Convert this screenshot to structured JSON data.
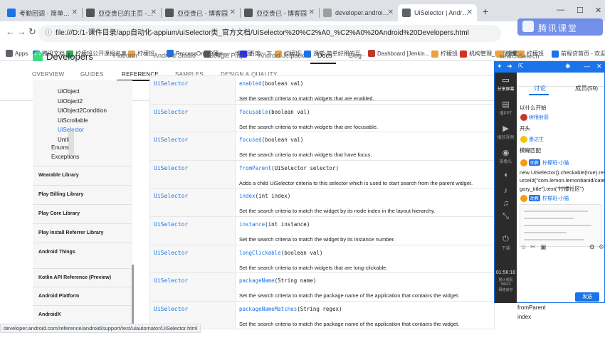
{
  "browser": {
    "tabs": [
      {
        "title": "考勤回调 · 简单好用的互动课堂S",
        "icon_color": "#1a73e8"
      },
      {
        "title": "亞亞贵已的主页 - 博客园",
        "icon_color": "#555555"
      },
      {
        "title": "亞亞贵已 - 博客园",
        "icon_color": "#555555"
      },
      {
        "title": "亞亞贵已 - 博客园",
        "icon_color": "#555555"
      },
      {
        "title": "developer.android.com",
        "icon_color": "#9e9e9e"
      },
      {
        "title": "UiSelector | Android Develop",
        "icon_color": "#5f6368"
      }
    ],
    "active_tab_index": 5,
    "new_tab_icon": "plus-icon",
    "url": "file:///D:/1-课件目录/app自动化-appium/uiSelector类_官方文档/UiSelector%20%C2%A0_%C2%A0%20Android%20Developers.html",
    "bookmarks": [
      {
        "label": "Apps",
        "color": "#5f6368"
      },
      {
        "label": "腾讯文档",
        "color": "#1a73e8"
      },
      {
        "label": "柠檬班公开课报名表",
        "color": "#34a853"
      },
      {
        "label": "柠檬班",
        "color": "#e8a33d"
      },
      {
        "label": "ProcessOn - Diagr...",
        "color": "#1a73e8"
      },
      {
        "label": "薄—— - 博客园",
        "color": "#555555"
      },
      {
        "label": "百度一下",
        "color": "#2932e1"
      },
      {
        "label": "柠檬班",
        "color": "#e8a33d"
      },
      {
        "label": "课堂-简单好用的互...",
        "color": "#1a73e8"
      },
      {
        "label": "Dashboard [Jenkin...",
        "color": "#c0392b"
      },
      {
        "label": "柠檬班",
        "color": "#e8a33d"
      },
      {
        "label": "机构管理_腾讯课堂",
        "color": "#d93025"
      },
      {
        "label": "柠檬班",
        "color": "#e8a33d"
      },
      {
        "label": "柠檬班",
        "color": "#e8a33d"
      },
      {
        "label": "前程贷首页 - 欢迎您",
        "color": "#1a73e8"
      }
    ],
    "status_url": "developer.android.com/reference/android/support/test/uiautomator/UiSelector.html"
  },
  "site": {
    "brand": "Developers",
    "top_nav": [
      "Platform",
      "Android Studio",
      "Google Play",
      "Android Jetpack",
      "Docs",
      "Blog"
    ],
    "top_nav_active": "Docs",
    "search_placeholder": "searchSearch",
    "sub_nav": [
      "OVERVIEW",
      "GUIDES",
      "REFERENCE",
      "SAMPLES",
      "DESIGN & QUALITY"
    ],
    "sub_nav_active": "REFERENCE"
  },
  "sidebar": {
    "classes": [
      "UiObject",
      "UiObject2",
      "UiObject2Condition",
      "UiScrollable",
      "UiSelector",
      "UntiI"
    ],
    "active_class": "UiSelector",
    "groups": [
      "Enums",
      "Exceptions"
    ],
    "sections": [
      "Wearable Library",
      "Play Billing Library",
      "Play Core Library",
      "Play Install Referrer Library",
      "Android Things",
      "Kotlin API Reference (Preview)",
      "Android Platform",
      "AndroidX"
    ]
  },
  "methods": [
    {
      "type": "UiSelector",
      "name": "enabled",
      "params": "(boolean val)",
      "desc": "Set the search criteria to match widgets that are enabled."
    },
    {
      "type": "UiSelector",
      "name": "focusable",
      "params": "(boolean val)",
      "desc": "Set the search criteria to match widgets that are focusable."
    },
    {
      "type": "UiSelector",
      "name": "focused",
      "params": "(boolean val)",
      "desc": "Set the search criteria to match widgets that have focus."
    },
    {
      "type": "UiSelector",
      "name": "fromParent",
      "params": "(UiSelector selector)",
      "desc": "Adds a child UiSelector criteria to this selector which is used to start search from the parent widget."
    },
    {
      "type": "UiSelector",
      "name": "index",
      "params": "(int index)",
      "desc": "Set the search criteria to match the widget by its node index in the layout hierarchy."
    },
    {
      "type": "UiSelector",
      "name": "instance",
      "params": "(int instance)",
      "desc": "Set the search criteria to match the widget by its instance number."
    },
    {
      "type": "UiSelector",
      "name": "longClickable",
      "params": "(boolean val)",
      "desc": "Set the search criteria to match widgets that are long-clickable."
    },
    {
      "type": "UiSelector",
      "name": "packageName",
      "params": "(String name)",
      "desc": "Set the search criteria to match the package name of the application that contains the widget."
    },
    {
      "type": "UiSelector",
      "name": "packageNameMatches",
      "params": "(String regex)",
      "desc": "Set the search criteria to match the package name of the application that contains the widget."
    }
  ],
  "right_outline": [
    "fromParent",
    "index"
  ],
  "overlay": {
    "logo_text": "腾讯课堂",
    "left_rail": [
      {
        "label": "分享屏幕",
        "icon": "screen-share-icon"
      },
      {
        "label": "播PPT",
        "icon": "ppt-icon"
      },
      {
        "label": "播放视频",
        "icon": "video-icon"
      },
      {
        "label": "摄像头",
        "icon": "camera-icon"
      },
      {
        "label": "",
        "icon": "mic-icon"
      },
      {
        "label": "",
        "icon": "speaker-icon"
      },
      {
        "label": "",
        "icon": "music-icon"
      },
      {
        "label": "",
        "icon": "collapse-icon"
      },
      {
        "label": "下课",
        "icon": "end-class-icon"
      }
    ],
    "elapsed": "01:56:16",
    "stats": [
      "累计观看",
      "58410",
      "网络良好"
    ],
    "chat_tabs": [
      "讨论",
      "成员(59)"
    ],
    "messages": [
      {
        "who": "",
        "text": "以什么开始",
        "tag": ""
      },
      {
        "who": "树根射箭",
        "text": "开头",
        "tag": ""
      },
      {
        "who": "墨达生",
        "text": "模糊匹配",
        "tag": ""
      },
      {
        "who": "柠檬班-小猫",
        "text": "new UiSelector().checkable(true).reso",
        "tag": "助教"
      },
      {
        "who": "",
        "text": "urceId(\"com.lemon.lemonbanid/cate",
        "tag": ""
      },
      {
        "who": "",
        "text": "gory_title\").text(\"柠檬社区\")",
        "tag": ""
      },
      {
        "who": "柠檬班-小猫",
        "text": "",
        "tag": "助教"
      }
    ],
    "send_label": "发送"
  }
}
